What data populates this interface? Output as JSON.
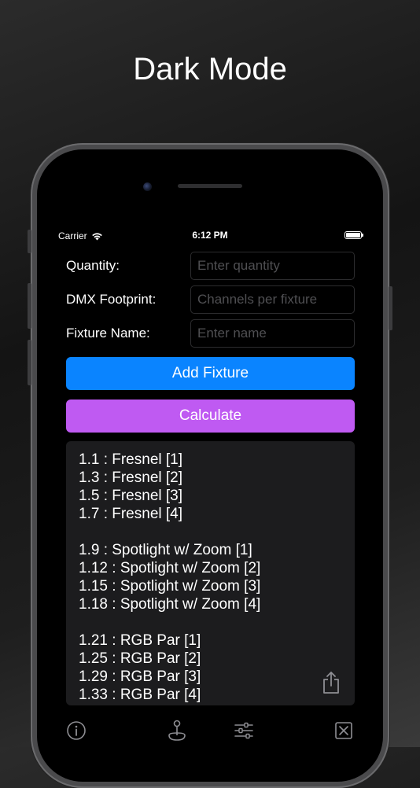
{
  "headline": "Dark Mode",
  "status_bar": {
    "carrier": "Carrier",
    "time": "6:12 PM"
  },
  "form": {
    "quantity": {
      "label": "Quantity:",
      "value": "",
      "placeholder": "Enter quantity"
    },
    "footprint": {
      "label": "DMX Footprint:",
      "value": "",
      "placeholder": "Channels per fixture"
    },
    "name": {
      "label": "Fixture Name:",
      "value": "",
      "placeholder": "Enter name"
    }
  },
  "buttons": {
    "add_fixture": "Add Fixture",
    "calculate": "Calculate"
  },
  "results": [
    "1.1 : Fresnel [1]",
    "1.3 : Fresnel [2]",
    "1.5 : Fresnel [3]",
    "1.7 : Fresnel [4]",
    "1.9 : Spotlight w/ Zoom [1]",
    "1.12 : Spotlight w/ Zoom [2]",
    "1.15 : Spotlight w/ Zoom [3]",
    "1.18 : Spotlight w/ Zoom [4]",
    "1.21 : RGB Par [1]",
    "1.25 : RGB Par [2]",
    "1.29 : RGB Par [3]",
    "1.33 : RGB Par [4]"
  ],
  "icons": {
    "share": "share-icon",
    "info": "info-icon",
    "joystick": "joystick-icon",
    "sliders": "sliders-icon",
    "clear": "clear-icon"
  },
  "colors": {
    "add_button": "#0a84ff",
    "calculate_button": "#bf5af2",
    "results_background": "#1c1c1e"
  }
}
